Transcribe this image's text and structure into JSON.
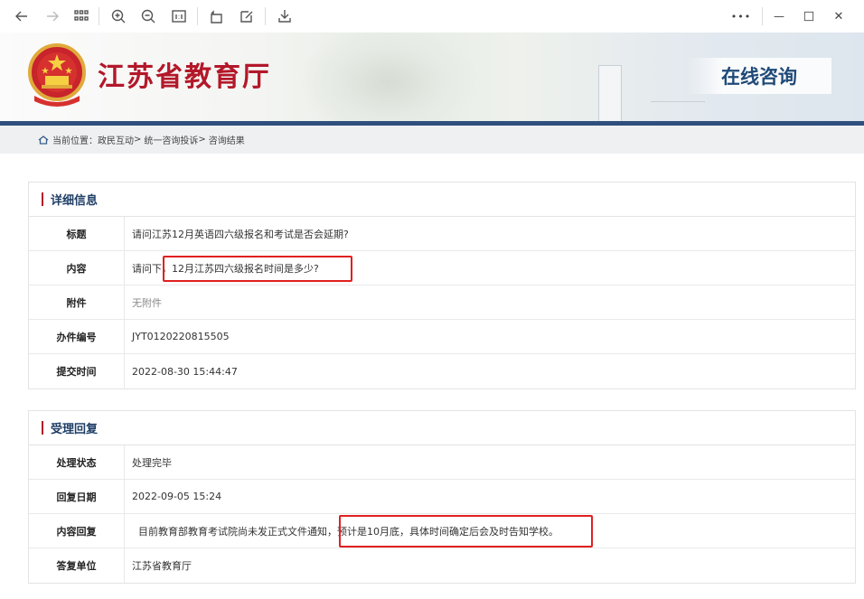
{
  "toolbar": {
    "buttons": [
      {
        "name": "back-icon"
      },
      {
        "name": "forward-icon"
      },
      {
        "name": "grid-view-icon"
      },
      {
        "name": "zoom-in-icon"
      },
      {
        "name": "zoom-out-icon"
      },
      {
        "name": "actual-size-icon"
      },
      {
        "name": "rotate-icon"
      },
      {
        "name": "edit-icon"
      },
      {
        "name": "download-icon"
      }
    ],
    "more_label": "•••",
    "minimize_label": "—",
    "close_label": "✕"
  },
  "banner": {
    "site_title": "江苏省教育厅",
    "section_title": "在线咨询"
  },
  "breadcrumb": {
    "prefix": "当前位置：",
    "items": [
      "政民互动",
      "统一咨询投诉",
      "咨询结果"
    ],
    "separator": ">"
  },
  "details": {
    "heading": "详细信息",
    "rows": [
      {
        "label": "标题",
        "value": "请问江苏12月英语四六级报名和考试是否会延期?"
      },
      {
        "label": "内容",
        "value": "请问下，12月江苏四六级报名时间是多少?"
      },
      {
        "label": "附件",
        "value": "无附件"
      },
      {
        "label": "办件编号",
        "value": "JYT0120220815505"
      },
      {
        "label": "提交时间",
        "value": "2022-08-30 15:44:47"
      }
    ]
  },
  "reply": {
    "heading": "受理回复",
    "rows": [
      {
        "label": "处理状态",
        "value": "处理完毕"
      },
      {
        "label": "回复日期",
        "value": "2022-09-05 15:24"
      },
      {
        "label": "内容回复",
        "value": "  目前教育部教育考试院尚未发正式文件通知，预计是10月底，具体时间确定后会及时告知学校。"
      },
      {
        "label": "答复单位",
        "value": "江苏省教育厅"
      }
    ]
  },
  "colors": {
    "accent_red": "#b3182a",
    "header_blue": "#2f4f7e",
    "highlight_red": "#e02020"
  }
}
